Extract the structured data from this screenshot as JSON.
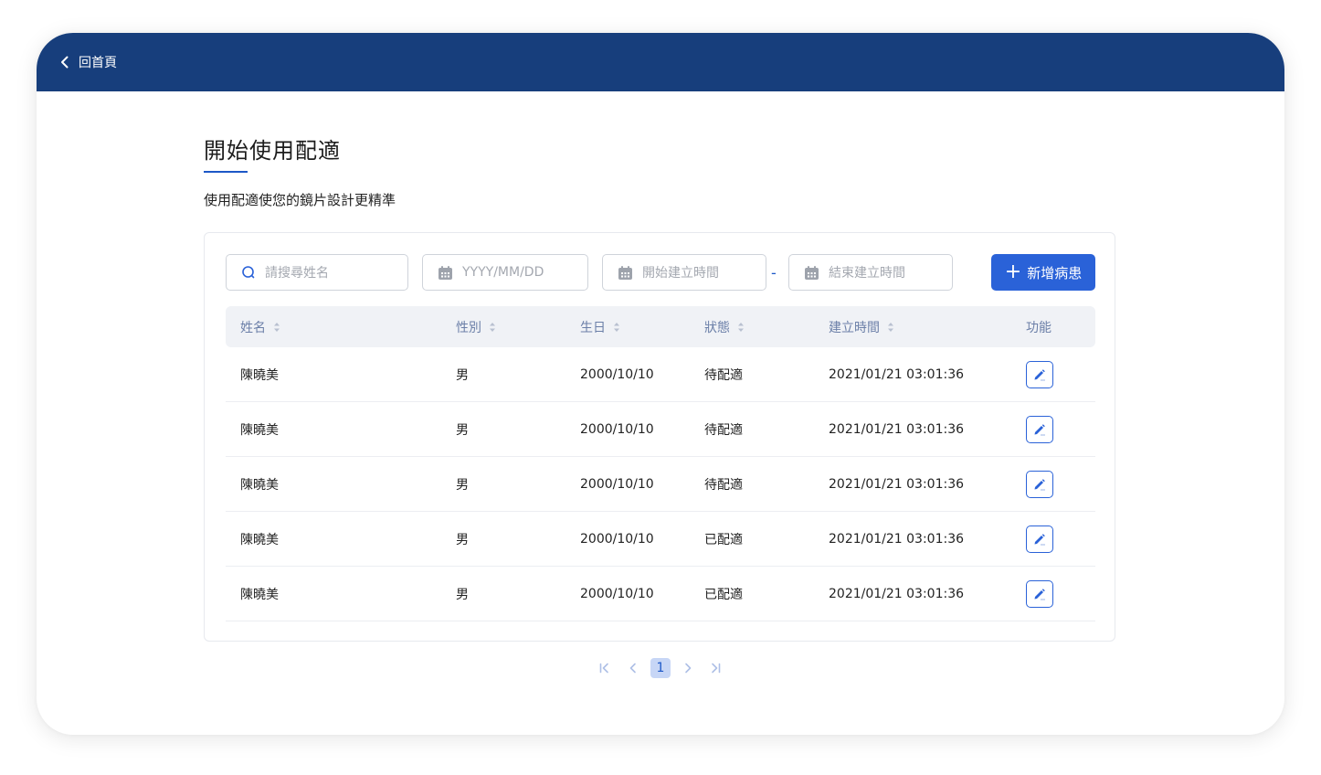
{
  "header": {
    "back_label": "回首頁",
    "bg_color": "#173e7c"
  },
  "page": {
    "title": "開始使用配適",
    "subtitle": "使用配適使您的鏡片設計更精準"
  },
  "filters": {
    "search_placeholder": "請搜尋姓名",
    "birth_placeholder": "YYYY/MM/DD",
    "start_placeholder": "開始建立時間",
    "range_separator": "-",
    "end_placeholder": "結束建立時間"
  },
  "actions": {
    "add_label": "新增病患",
    "accent_color": "#2a62d8"
  },
  "table": {
    "columns": [
      "姓名",
      "性別",
      "生日",
      "狀態",
      "建立時間",
      "功能"
    ],
    "rows": [
      {
        "name": "陳曉美",
        "gender": "男",
        "birth": "2000/10/10",
        "status": "待配適",
        "created": "2021/01/21 03:01:36"
      },
      {
        "name": "陳曉美",
        "gender": "男",
        "birth": "2000/10/10",
        "status": "待配適",
        "created": "2021/01/21 03:01:36"
      },
      {
        "name": "陳曉美",
        "gender": "男",
        "birth": "2000/10/10",
        "status": "待配適",
        "created": "2021/01/21 03:01:36"
      },
      {
        "name": "陳曉美",
        "gender": "男",
        "birth": "2000/10/10",
        "status": "已配適",
        "created": "2021/01/21 03:01:36"
      },
      {
        "name": "陳曉美",
        "gender": "男",
        "birth": "2000/10/10",
        "status": "已配適",
        "created": "2021/01/21 03:01:36"
      }
    ]
  },
  "pagination": {
    "current_page": "1"
  }
}
